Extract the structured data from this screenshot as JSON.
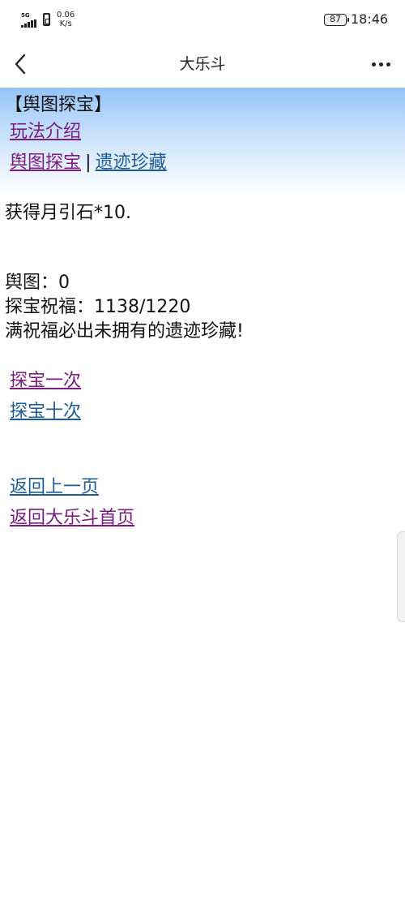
{
  "status_bar": {
    "signal_label": "5G",
    "net_speed_value": "0.06",
    "net_speed_unit": "K/s",
    "battery": "87",
    "time": "18:46"
  },
  "nav": {
    "title": "大乐斗",
    "back_icon": "chevron-left-icon",
    "more_icon": "more-horizontal-icon"
  },
  "page": {
    "heading": "【舆图探宝】",
    "links": {
      "intro": "玩法介绍",
      "treasure_map": "舆图探宝",
      "separator": "|",
      "relics": "遗迹珍藏",
      "search_once": "探宝一次",
      "search_ten": "探宝十次",
      "back_prev": "返回上一页",
      "back_home": "返回大乐斗首页"
    },
    "result_message": "获得月引石*10.",
    "map_count": "舆图：0",
    "blessing": "探宝祝福：1138/1220",
    "blessing_note": "满祝福必出未拥有的遗迹珍藏!"
  },
  "colors": {
    "visited_link": "#7b1b82",
    "link": "#1d5b96",
    "header_gradient_top": "#93c3f7"
  }
}
